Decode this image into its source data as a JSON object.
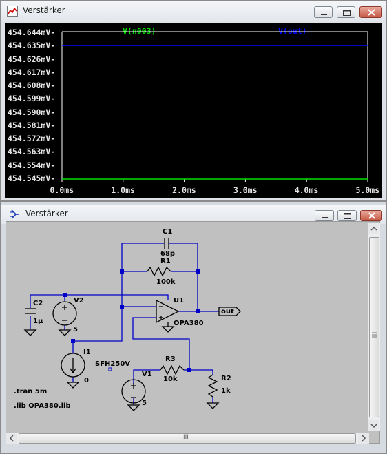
{
  "waveform_window": {
    "title": "Verstärker",
    "icon": "waveform-icon",
    "traces": [
      {
        "name": "V(n003)",
        "color": "#00e000"
      },
      {
        "name": "V(out)",
        "color": "#0000ff"
      }
    ],
    "y_labels": [
      "454.644mV-",
      "454.635mV-",
      "454.626mV-",
      "454.617mV-",
      "454.608mV-",
      "454.599mV-",
      "454.590mV-",
      "454.581mV-",
      "454.572mV-",
      "454.563mV-",
      "454.554mV-",
      "454.545mV-"
    ],
    "x_labels": [
      "0.0ms",
      "1.0ms",
      "2.0ms",
      "3.0ms",
      "4.0ms",
      "5.0ms"
    ]
  },
  "chart_data": {
    "type": "line",
    "x": [
      0,
      5
    ],
    "xlim": [
      0,
      5
    ],
    "ylim": [
      454.545,
      454.644
    ],
    "series": [
      {
        "name": "V(n003)",
        "color": "#00e000",
        "values": [
          454.545,
          454.545
        ]
      },
      {
        "name": "V(out)",
        "color": "#0000ff",
        "values": [
          454.6355,
          454.6355
        ]
      }
    ]
  },
  "schematic_window": {
    "title": "Verstärker",
    "icon": "schematic-icon",
    "components": {
      "c1": {
        "name": "C1",
        "value": "68p"
      },
      "r1": {
        "name": "R1",
        "value": "100k"
      },
      "c2": {
        "name": "C2",
        "value": "1µ"
      },
      "v2": {
        "name": "V2",
        "value": "5"
      },
      "u1": {
        "name": "U1",
        "value": "OPA380"
      },
      "i1": {
        "name": "I1",
        "value": "0",
        "extra": "SFH250V"
      },
      "r3": {
        "name": "R3",
        "value": "10k"
      },
      "v1": {
        "name": "V1",
        "value": "5"
      },
      "r2": {
        "name": "R2",
        "value": "1k"
      }
    },
    "net_label": "out",
    "directives": [
      ".tran 5m",
      ".lib OPA380.lib"
    ],
    "scroll_grip": "III"
  }
}
